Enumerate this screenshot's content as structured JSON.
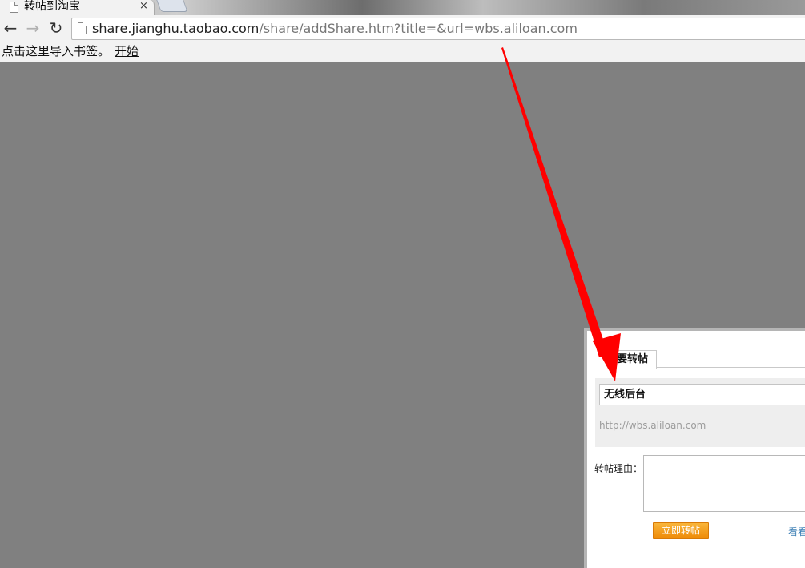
{
  "browser": {
    "tab_title": "转帖到淘宝",
    "tab_close": "×",
    "url_host": "share.jianghu.taobao.com",
    "url_path": "/share/addShare.htm?title=&url=wbs.aliloan.com",
    "nav": {
      "back": "←",
      "forward": "→",
      "reload": "↻"
    }
  },
  "bookmarks_bar": {
    "prompt": "点击这里导入书签。",
    "start_link": "开始"
  },
  "share_panel": {
    "tab_label": "我要转帖",
    "title_value": "无线后台",
    "url_text": "http://wbs.aliloan.com",
    "reason_label": "转帖理由：",
    "reason_value": "",
    "submit_label": "立即转帖",
    "see_link": "看看"
  },
  "annotation": {
    "color": "#ff0000"
  }
}
